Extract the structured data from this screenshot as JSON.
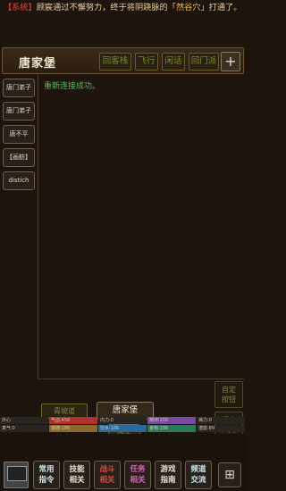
{
  "system_message": {
    "tag": "【系统】",
    "text_before": "顾宸通过不懈努力，终于将阴跷脉的「",
    "highlight": "然谷穴",
    "text_after": "」打通了。"
  },
  "header": {
    "title": "唐家堡",
    "buttons": [
      "回客栈",
      "飞行",
      "闲话",
      "回门派"
    ],
    "plus_label": "+"
  },
  "sidebar": {
    "items": [
      "唐门弟子",
      "唐门弟子",
      "唐不平",
      "【画舫】",
      "distich"
    ]
  },
  "log": {
    "lines": [
      "重新连接成功。"
    ]
  },
  "exits": {
    "west": "青坡道",
    "south": "南堂"
  },
  "room_name": "唐家堡",
  "right_buttons": [
    {
      "line1": "自定",
      "line2": "按钮"
    },
    {
      "line1": "观察",
      "line2": "四周"
    }
  ],
  "stats": [
    {
      "label": "外心",
      "fill": 0.0,
      "color": "#3a3a3a"
    },
    {
      "label": "气血:456",
      "fill": 1.0,
      "color": "#b03030"
    },
    {
      "label": "内力:0",
      "fill": 0.0,
      "color": "#2a3a5a"
    },
    {
      "label": "精神:200",
      "fill": 1.0,
      "color": "#7a4aa0"
    },
    {
      "label": "禅力:0",
      "fill": 0.0,
      "color": "#3a3a3a"
    },
    {
      "label": "真气:0",
      "fill": 0.0,
      "color": "#3a3a3a"
    },
    {
      "label": "道德:186",
      "fill": 1.0,
      "color": "#8a6a2a"
    },
    {
      "label": "饮水:186",
      "fill": 1.0,
      "color": "#2a6a9a"
    },
    {
      "label": "食物:186",
      "fill": 1.0,
      "color": "#2a7a5a"
    },
    {
      "label": "潜能:89",
      "fill": 0.0,
      "color": "#3a3a3a"
    }
  ],
  "bottom_buttons": [
    {
      "line1": "常用",
      "line2": "指令",
      "style": "light"
    },
    {
      "line1": "技能",
      "line2": "相关",
      "style": ""
    },
    {
      "line1": "战斗",
      "line2": "相关",
      "style": "red"
    },
    {
      "line1": "任务",
      "line2": "相关",
      "style": "pink"
    },
    {
      "line1": "游戏",
      "line2": "指南",
      "style": ""
    },
    {
      "line1": "频道",
      "line2": "交流",
      "style": "light"
    }
  ],
  "grid_icon": "grid-icon"
}
